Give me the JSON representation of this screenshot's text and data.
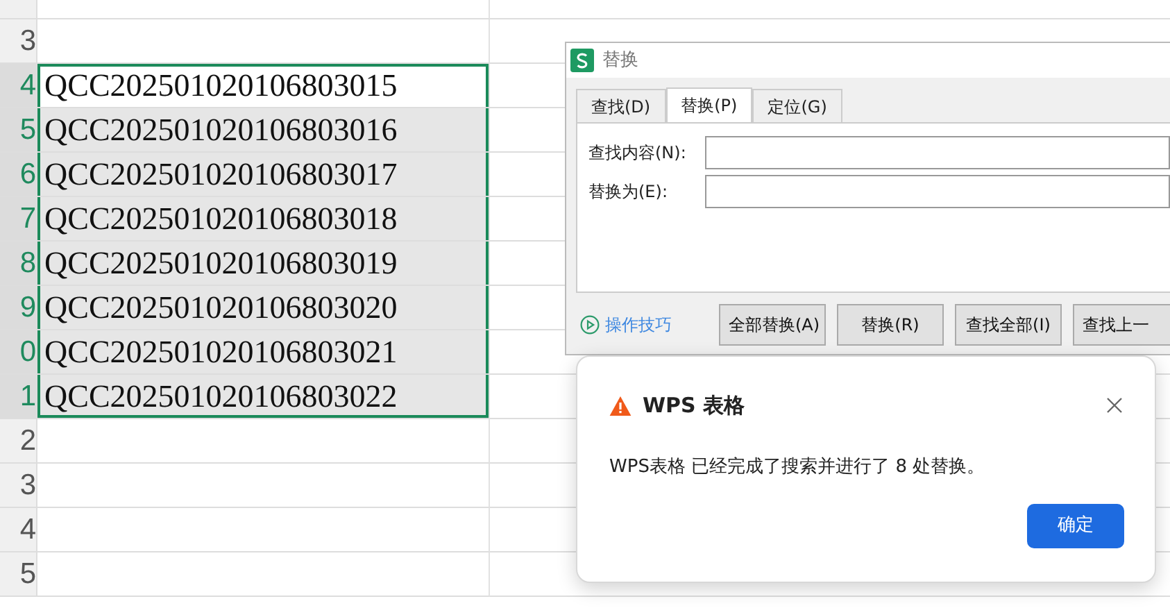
{
  "sheet": {
    "rows": [
      {
        "header": null,
        "cell": null,
        "selected": false,
        "active": false
      },
      {
        "header": "3",
        "cell": null,
        "selected": false,
        "active": false
      },
      {
        "header": "4",
        "cell": "QCC202501020106803015",
        "selected": true,
        "active": true
      },
      {
        "header": "5",
        "cell": "QCC202501020106803016",
        "selected": true,
        "active": false
      },
      {
        "header": "6",
        "cell": "QCC202501020106803017",
        "selected": true,
        "active": false
      },
      {
        "header": "7",
        "cell": "QCC202501020106803018",
        "selected": true,
        "active": false
      },
      {
        "header": "8",
        "cell": "QCC202501020106803019",
        "selected": true,
        "active": false
      },
      {
        "header": "9",
        "cell": "QCC202501020106803020",
        "selected": true,
        "active": false
      },
      {
        "header": "0",
        "cell": "QCC202501020106803021",
        "selected": true,
        "active": false
      },
      {
        "header": "1",
        "cell": "QCC202501020106803022",
        "selected": true,
        "active": false
      },
      {
        "header": "2",
        "cell": null,
        "selected": false,
        "active": false
      },
      {
        "header": "3",
        "cell": null,
        "selected": false,
        "active": false
      },
      {
        "header": "4",
        "cell": null,
        "selected": false,
        "active": false
      },
      {
        "header": "5",
        "cell": null,
        "selected": false,
        "active": false
      }
    ]
  },
  "replace_dialog": {
    "title": "替换",
    "tabs": [
      {
        "label": "查找(D)",
        "selected": false
      },
      {
        "label": "替换(P)",
        "selected": true
      },
      {
        "label": "定位(G)",
        "selected": false
      }
    ],
    "fields": [
      {
        "label": "查找内容(N):"
      },
      {
        "label": "替换为(E):"
      }
    ],
    "tips_link": "操作技巧",
    "buttons": [
      "全部替换(A)",
      "替换(R)",
      "查找全部(I)",
      "查找上一"
    ]
  },
  "message_box": {
    "title": "WPS 表格",
    "message": "WPS表格 已经完成了搜索并进行了 8 处替换。",
    "ok_button": "确定"
  }
}
